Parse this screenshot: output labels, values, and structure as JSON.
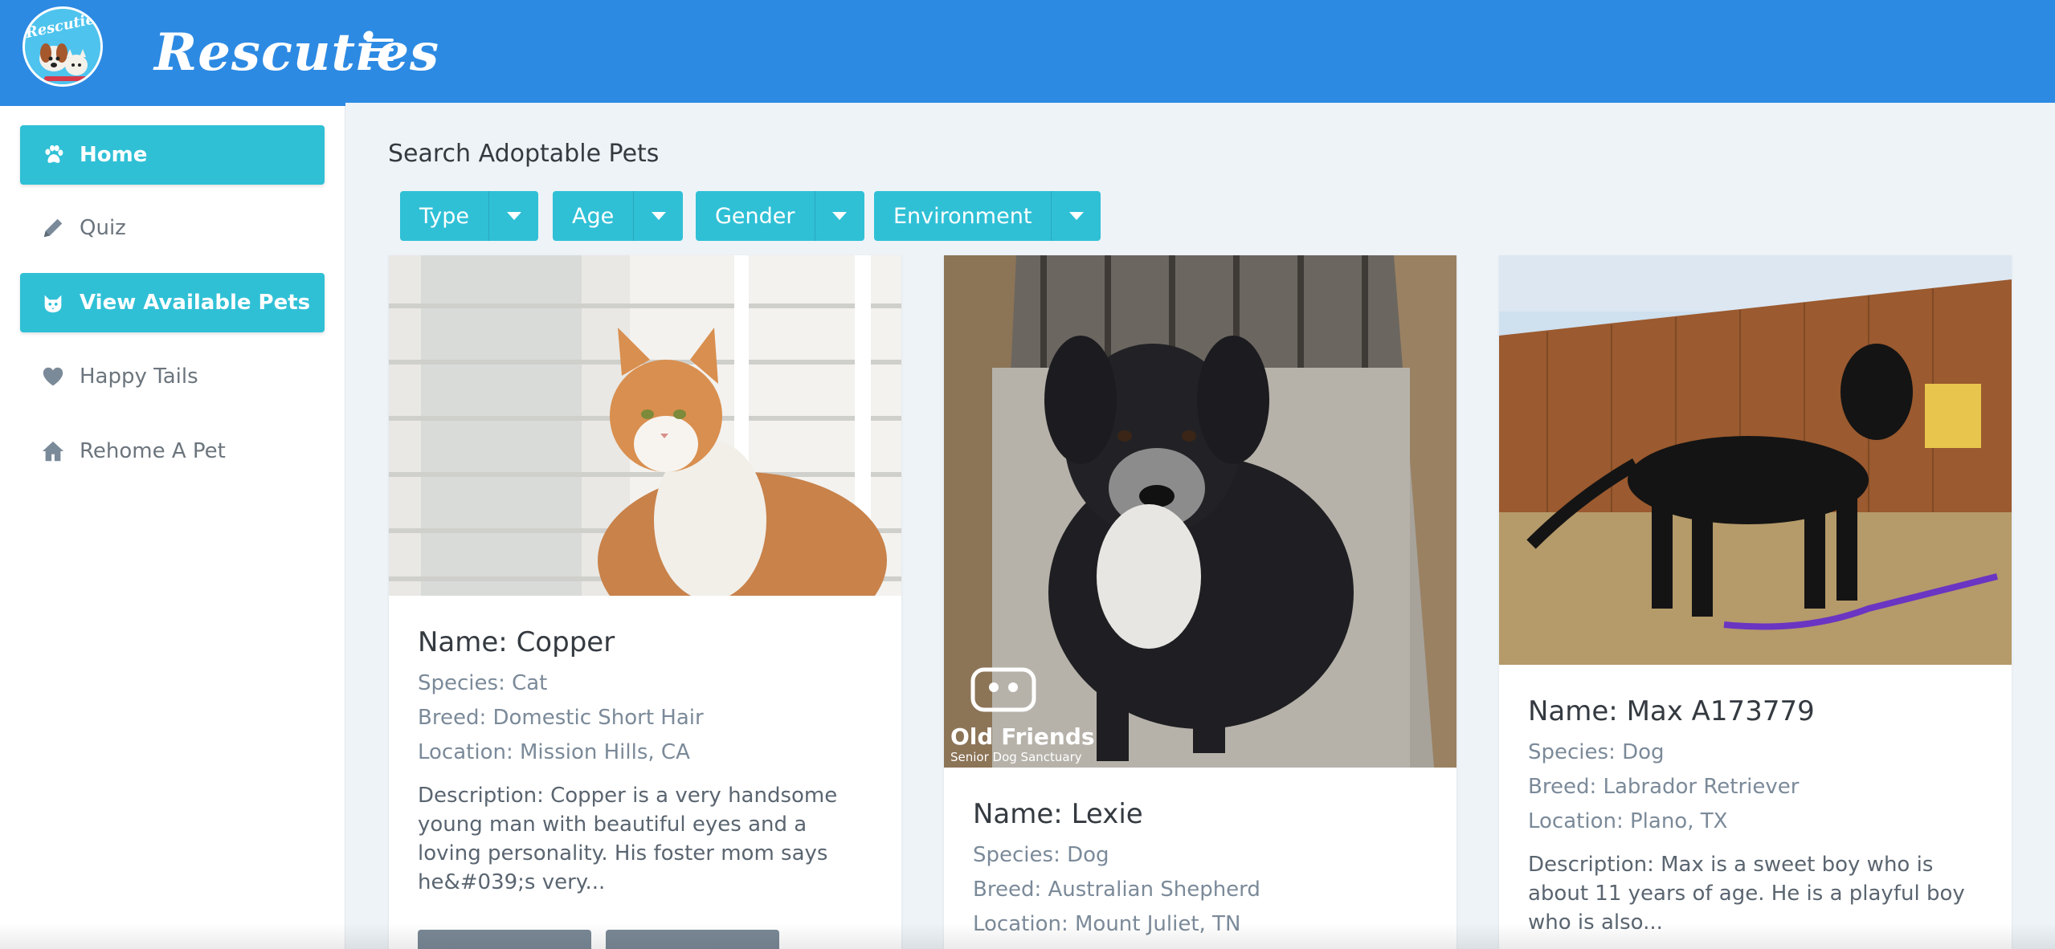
{
  "brand": {
    "name": "Rescuties",
    "logo_text": "Rescuties"
  },
  "sidebar": {
    "items": [
      {
        "label": "Home",
        "icon": "paw-icon",
        "active": true
      },
      {
        "label": "Quiz",
        "icon": "pencil-icon",
        "active": false
      },
      {
        "label": "View Available Pets",
        "icon": "cat-icon",
        "active": true
      },
      {
        "label": "Happy Tails",
        "icon": "heart-icon",
        "active": false
      },
      {
        "label": "Rehome A Pet",
        "icon": "home-icon",
        "active": false
      }
    ]
  },
  "main": {
    "title": "Search Adoptable Pets",
    "filters": [
      {
        "label": "Type"
      },
      {
        "label": "Age"
      },
      {
        "label": "Gender"
      },
      {
        "label": "Environment"
      }
    ]
  },
  "pets": [
    {
      "name": "Name: Copper",
      "species": "Species: Cat",
      "breed": "Breed: Domestic Short Hair",
      "location": "Location: Mission Hills, CA",
      "description": "Description: Copper is a very handsome young man with beautiful eyes and a loving personality. His foster mom says he&#039;s very..."
    },
    {
      "name": "Name: Lexie",
      "species": "Species: Dog",
      "breed": "Breed: Australian Shepherd",
      "location": "Location: Mount Juliet, TN",
      "watermark_title": "Old Friends",
      "watermark_sub": "Senior Dog Sanctuary"
    },
    {
      "name": "Name: Max A173779",
      "species": "Species: Dog",
      "breed": "Breed: Labrador Retriever",
      "location": "Location: Plano, TX",
      "description": "Description: Max is a sweet boy who is about 11 years of age. He is a playful boy who is also..."
    }
  ],
  "colors": {
    "header": "#2d8ae3",
    "accent": "#2fc0d6",
    "background": "#edf3f7"
  }
}
